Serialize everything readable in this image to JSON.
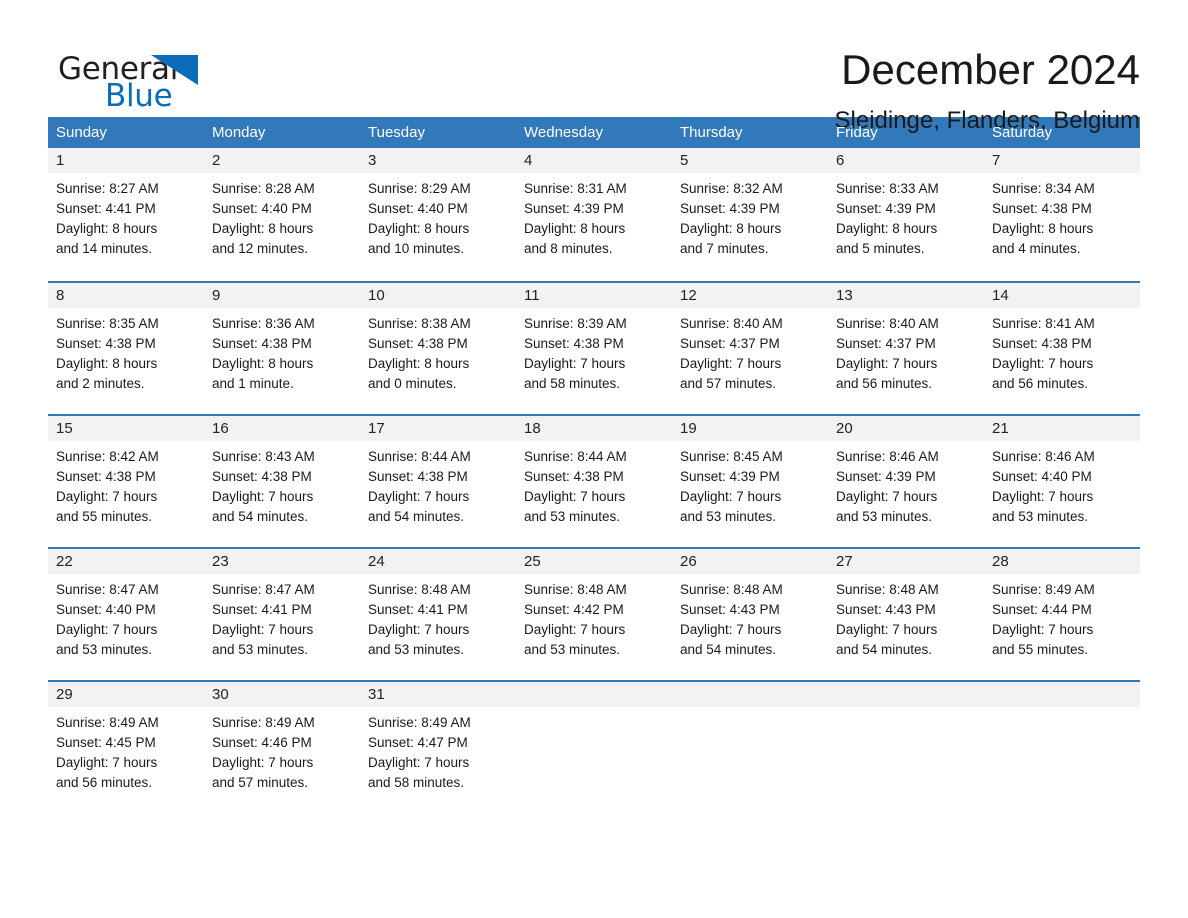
{
  "brand": {
    "name_part1": "General",
    "name_part2": "Blue",
    "logo_icon": "triangle-flag-icon",
    "color_dark": "#231f20",
    "color_blue": "#0b6cb7"
  },
  "header": {
    "title": "December 2024",
    "subtitle": "Sleidinge, Flanders, Belgium"
  },
  "theme": {
    "header_row_bg": "#3279bb",
    "day_band_bg": "#f2f2f2",
    "row_divider": "#3279bb"
  },
  "calendar": {
    "weekdays": [
      "Sunday",
      "Monday",
      "Tuesday",
      "Wednesday",
      "Thursday",
      "Friday",
      "Saturday"
    ],
    "weeks": [
      [
        {
          "day": "1",
          "sunrise": "Sunrise: 8:27 AM",
          "sunset": "Sunset: 4:41 PM",
          "daylight1": "Daylight: 8 hours",
          "daylight2": "and 14 minutes."
        },
        {
          "day": "2",
          "sunrise": "Sunrise: 8:28 AM",
          "sunset": "Sunset: 4:40 PM",
          "daylight1": "Daylight: 8 hours",
          "daylight2": "and 12 minutes."
        },
        {
          "day": "3",
          "sunrise": "Sunrise: 8:29 AM",
          "sunset": "Sunset: 4:40 PM",
          "daylight1": "Daylight: 8 hours",
          "daylight2": "and 10 minutes."
        },
        {
          "day": "4",
          "sunrise": "Sunrise: 8:31 AM",
          "sunset": "Sunset: 4:39 PM",
          "daylight1": "Daylight: 8 hours",
          "daylight2": "and 8 minutes."
        },
        {
          "day": "5",
          "sunrise": "Sunrise: 8:32 AM",
          "sunset": "Sunset: 4:39 PM",
          "daylight1": "Daylight: 8 hours",
          "daylight2": "and 7 minutes."
        },
        {
          "day": "6",
          "sunrise": "Sunrise: 8:33 AM",
          "sunset": "Sunset: 4:39 PM",
          "daylight1": "Daylight: 8 hours",
          "daylight2": "and 5 minutes."
        },
        {
          "day": "7",
          "sunrise": "Sunrise: 8:34 AM",
          "sunset": "Sunset: 4:38 PM",
          "daylight1": "Daylight: 8 hours",
          "daylight2": "and 4 minutes."
        }
      ],
      [
        {
          "day": "8",
          "sunrise": "Sunrise: 8:35 AM",
          "sunset": "Sunset: 4:38 PM",
          "daylight1": "Daylight: 8 hours",
          "daylight2": "and 2 minutes."
        },
        {
          "day": "9",
          "sunrise": "Sunrise: 8:36 AM",
          "sunset": "Sunset: 4:38 PM",
          "daylight1": "Daylight: 8 hours",
          "daylight2": "and 1 minute."
        },
        {
          "day": "10",
          "sunrise": "Sunrise: 8:38 AM",
          "sunset": "Sunset: 4:38 PM",
          "daylight1": "Daylight: 8 hours",
          "daylight2": "and 0 minutes."
        },
        {
          "day": "11",
          "sunrise": "Sunrise: 8:39 AM",
          "sunset": "Sunset: 4:38 PM",
          "daylight1": "Daylight: 7 hours",
          "daylight2": "and 58 minutes."
        },
        {
          "day": "12",
          "sunrise": "Sunrise: 8:40 AM",
          "sunset": "Sunset: 4:37 PM",
          "daylight1": "Daylight: 7 hours",
          "daylight2": "and 57 minutes."
        },
        {
          "day": "13",
          "sunrise": "Sunrise: 8:40 AM",
          "sunset": "Sunset: 4:37 PM",
          "daylight1": "Daylight: 7 hours",
          "daylight2": "and 56 minutes."
        },
        {
          "day": "14",
          "sunrise": "Sunrise: 8:41 AM",
          "sunset": "Sunset: 4:38 PM",
          "daylight1": "Daylight: 7 hours",
          "daylight2": "and 56 minutes."
        }
      ],
      [
        {
          "day": "15",
          "sunrise": "Sunrise: 8:42 AM",
          "sunset": "Sunset: 4:38 PM",
          "daylight1": "Daylight: 7 hours",
          "daylight2": "and 55 minutes."
        },
        {
          "day": "16",
          "sunrise": "Sunrise: 8:43 AM",
          "sunset": "Sunset: 4:38 PM",
          "daylight1": "Daylight: 7 hours",
          "daylight2": "and 54 minutes."
        },
        {
          "day": "17",
          "sunrise": "Sunrise: 8:44 AM",
          "sunset": "Sunset: 4:38 PM",
          "daylight1": "Daylight: 7 hours",
          "daylight2": "and 54 minutes."
        },
        {
          "day": "18",
          "sunrise": "Sunrise: 8:44 AM",
          "sunset": "Sunset: 4:38 PM",
          "daylight1": "Daylight: 7 hours",
          "daylight2": "and 53 minutes."
        },
        {
          "day": "19",
          "sunrise": "Sunrise: 8:45 AM",
          "sunset": "Sunset: 4:39 PM",
          "daylight1": "Daylight: 7 hours",
          "daylight2": "and 53 minutes."
        },
        {
          "day": "20",
          "sunrise": "Sunrise: 8:46 AM",
          "sunset": "Sunset: 4:39 PM",
          "daylight1": "Daylight: 7 hours",
          "daylight2": "and 53 minutes."
        },
        {
          "day": "21",
          "sunrise": "Sunrise: 8:46 AM",
          "sunset": "Sunset: 4:40 PM",
          "daylight1": "Daylight: 7 hours",
          "daylight2": "and 53 minutes."
        }
      ],
      [
        {
          "day": "22",
          "sunrise": "Sunrise: 8:47 AM",
          "sunset": "Sunset: 4:40 PM",
          "daylight1": "Daylight: 7 hours",
          "daylight2": "and 53 minutes."
        },
        {
          "day": "23",
          "sunrise": "Sunrise: 8:47 AM",
          "sunset": "Sunset: 4:41 PM",
          "daylight1": "Daylight: 7 hours",
          "daylight2": "and 53 minutes."
        },
        {
          "day": "24",
          "sunrise": "Sunrise: 8:48 AM",
          "sunset": "Sunset: 4:41 PM",
          "daylight1": "Daylight: 7 hours",
          "daylight2": "and 53 minutes."
        },
        {
          "day": "25",
          "sunrise": "Sunrise: 8:48 AM",
          "sunset": "Sunset: 4:42 PM",
          "daylight1": "Daylight: 7 hours",
          "daylight2": "and 53 minutes."
        },
        {
          "day": "26",
          "sunrise": "Sunrise: 8:48 AM",
          "sunset": "Sunset: 4:43 PM",
          "daylight1": "Daylight: 7 hours",
          "daylight2": "and 54 minutes."
        },
        {
          "day": "27",
          "sunrise": "Sunrise: 8:48 AM",
          "sunset": "Sunset: 4:43 PM",
          "daylight1": "Daylight: 7 hours",
          "daylight2": "and 54 minutes."
        },
        {
          "day": "28",
          "sunrise": "Sunrise: 8:49 AM",
          "sunset": "Sunset: 4:44 PM",
          "daylight1": "Daylight: 7 hours",
          "daylight2": "and 55 minutes."
        }
      ],
      [
        {
          "day": "29",
          "sunrise": "Sunrise: 8:49 AM",
          "sunset": "Sunset: 4:45 PM",
          "daylight1": "Daylight: 7 hours",
          "daylight2": "and 56 minutes."
        },
        {
          "day": "30",
          "sunrise": "Sunrise: 8:49 AM",
          "sunset": "Sunset: 4:46 PM",
          "daylight1": "Daylight: 7 hours",
          "daylight2": "and 57 minutes."
        },
        {
          "day": "31",
          "sunrise": "Sunrise: 8:49 AM",
          "sunset": "Sunset: 4:47 PM",
          "daylight1": "Daylight: 7 hours",
          "daylight2": "and 58 minutes."
        },
        {
          "day": "",
          "sunrise": "",
          "sunset": "",
          "daylight1": "",
          "daylight2": ""
        },
        {
          "day": "",
          "sunrise": "",
          "sunset": "",
          "daylight1": "",
          "daylight2": ""
        },
        {
          "day": "",
          "sunrise": "",
          "sunset": "",
          "daylight1": "",
          "daylight2": ""
        },
        {
          "day": "",
          "sunrise": "",
          "sunset": "",
          "daylight1": "",
          "daylight2": ""
        }
      ]
    ]
  }
}
